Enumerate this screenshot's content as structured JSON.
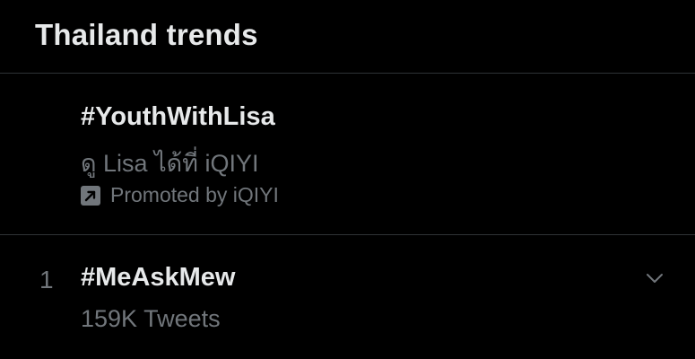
{
  "header": {
    "title": "Thailand trends"
  },
  "promoted_trend": {
    "hashtag": "#YouthWithLisa",
    "subtitle": "ดู Lisa ได้ที่ iQIYI",
    "promoted_label": "Promoted by iQIYI",
    "promoted_icon": "promoted-arrow-icon"
  },
  "trends": [
    {
      "rank": "1",
      "hashtag": "#MeAskMew",
      "count": "159K Tweets",
      "more_icon": "chevron-down-icon"
    }
  ],
  "colors": {
    "background": "#000000",
    "primary_text": "#e7e9ea",
    "secondary_text": "#71767b",
    "divider": "#2f3336"
  }
}
